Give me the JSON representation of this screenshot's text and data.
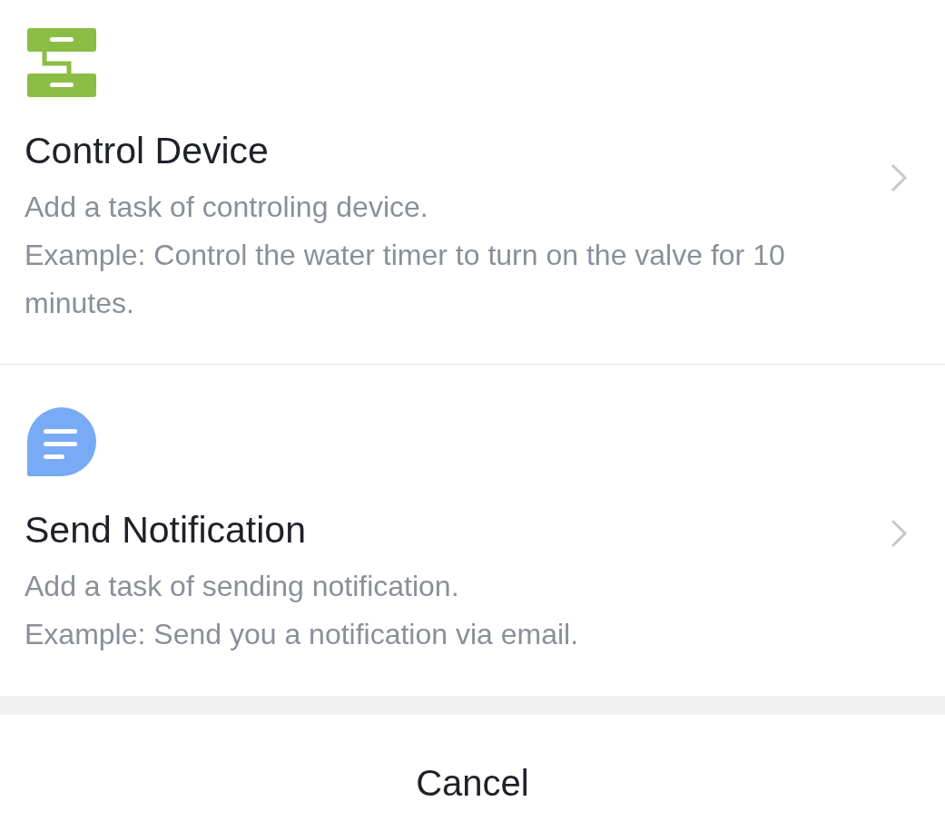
{
  "options": [
    {
      "kind": "device",
      "title": "Control Device",
      "description": [
        "Add a task of controling device.",
        "Example: Control the water timer to turn on the valve for 10 minutes."
      ]
    },
    {
      "kind": "notification",
      "title": "Send Notification",
      "description": [
        "Add a task of sending notification.",
        "Example: Send you a notification via email."
      ]
    }
  ],
  "cancel_button": {
    "label": "Cancel"
  }
}
